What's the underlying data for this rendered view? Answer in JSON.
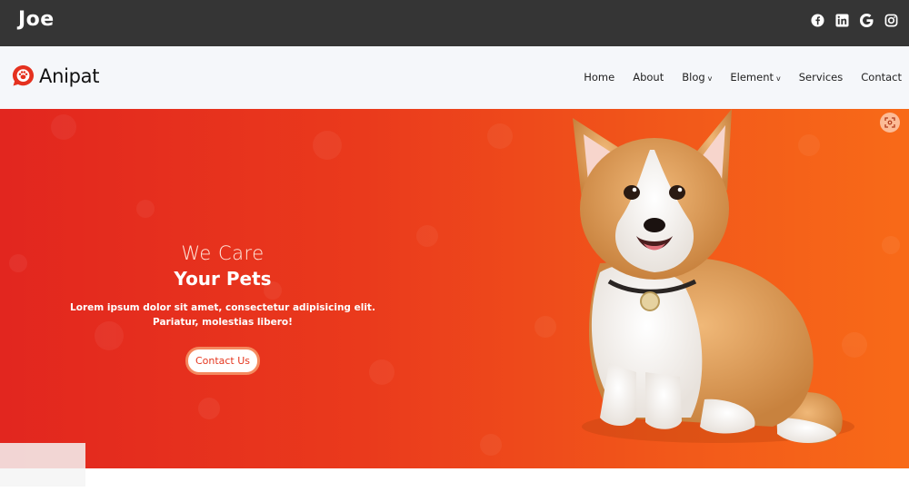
{
  "topbar": {
    "brand": "Joe",
    "socials": [
      {
        "icon": "facebook-icon"
      },
      {
        "icon": "linkedin-icon"
      },
      {
        "icon": "google-icon"
      },
      {
        "icon": "instagram-icon"
      }
    ]
  },
  "navbar": {
    "logo_text": "Anipat",
    "logo_color": "#e5311f",
    "items": [
      {
        "label": "Home",
        "dropdown": false
      },
      {
        "label": "About",
        "dropdown": false
      },
      {
        "label": "Blog",
        "dropdown": true
      },
      {
        "label": "Element",
        "dropdown": true
      },
      {
        "label": "Services",
        "dropdown": false
      },
      {
        "label": "Contact",
        "dropdown": false
      }
    ],
    "caret": "v"
  },
  "hero": {
    "line1": "We Care",
    "line2": "Your Pets",
    "text_line1": "Lorem ipsum dolor sit amet, consectetur adipisicing elit.",
    "text_line2": "Pariatur, molestias libero!",
    "cta_label": "Contact Us",
    "gradient": [
      "#e2261f",
      "#f86a18"
    ]
  },
  "colors": {
    "topbar_bg": "#353535",
    "nav_bg": "#f5f7fa",
    "accent": "#e5361e"
  }
}
